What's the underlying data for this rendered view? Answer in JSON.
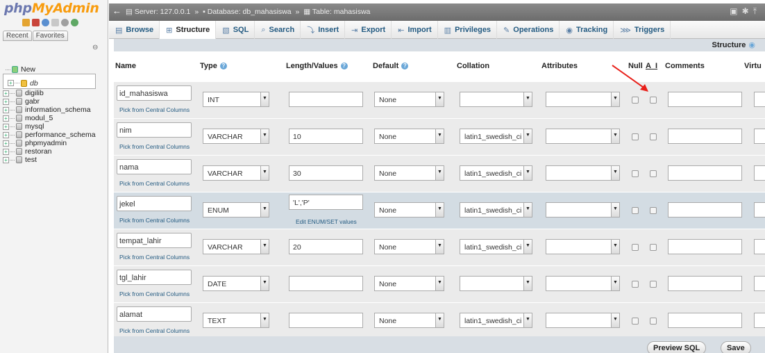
{
  "brand": {
    "part1": "php",
    "part2": "MyAdmin"
  },
  "nav": {
    "recent_tab": "Recent",
    "favorites_tab": "Favorites",
    "databases": [
      {
        "label": "New"
      },
      {
        "label": "db"
      },
      {
        "label": "digilib"
      },
      {
        "label": "gabr"
      },
      {
        "label": "information_schema"
      },
      {
        "label": "modul_5"
      },
      {
        "label": "mysql"
      },
      {
        "label": "performance_schema"
      },
      {
        "label": "phpmyadmin"
      },
      {
        "label": "restoran"
      },
      {
        "label": "test"
      }
    ]
  },
  "breadcrumb": {
    "server": "Server: 127.0.0.1",
    "database": "Database: db_mahasiswa",
    "table": "Table: mahasiswa",
    "separator": "»"
  },
  "tabs": [
    {
      "label": "Browse",
      "icon": "browse-icon"
    },
    {
      "label": "Structure",
      "icon": "structure-icon",
      "active": true
    },
    {
      "label": "SQL",
      "icon": "sql-icon"
    },
    {
      "label": "Search",
      "icon": "search-icon"
    },
    {
      "label": "Insert",
      "icon": "insert-icon"
    },
    {
      "label": "Export",
      "icon": "export-icon"
    },
    {
      "label": "Import",
      "icon": "import-icon"
    },
    {
      "label": "Privileges",
      "icon": "privileges-icon"
    },
    {
      "label": "Operations",
      "icon": "operations-icon"
    },
    {
      "label": "Tracking",
      "icon": "tracking-icon"
    },
    {
      "label": "Triggers",
      "icon": "triggers-icon"
    }
  ],
  "substrip": {
    "structure_link": "Structure"
  },
  "columns": {
    "name": "Name",
    "type": "Type",
    "length": "Length/Values",
    "default": "Default",
    "collation": "Collation",
    "attributes": "Attributes",
    "null": "Null",
    "ai": "A_I",
    "comments": "Comments",
    "virtual": "Virtu"
  },
  "pick_label": "Pick from Central Columns",
  "edit_enum_label": "Edit ENUM/SET values",
  "fields": [
    {
      "name": "id_mahasiswa",
      "type": "INT",
      "length": "",
      "default": "None",
      "collation": ""
    },
    {
      "name": "nim",
      "type": "VARCHAR",
      "length": "10",
      "default": "None",
      "collation": "latin1_swedish_ci"
    },
    {
      "name": "nama",
      "type": "VARCHAR",
      "length": "30",
      "default": "None",
      "collation": "latin1_swedish_ci"
    },
    {
      "name": "jekel",
      "type": "ENUM",
      "length": "'L','P'",
      "default": "None",
      "collation": "latin1_swedish_ci"
    },
    {
      "name": "tempat_lahir",
      "type": "VARCHAR",
      "length": "20",
      "default": "None",
      "collation": "latin1_swedish_ci"
    },
    {
      "name": "tgl_lahir",
      "type": "DATE",
      "length": "",
      "default": "None",
      "collation": ""
    },
    {
      "name": "alamat",
      "type": "TEXT",
      "length": "",
      "default": "None",
      "collation": "latin1_swedish_ci"
    }
  ],
  "buttons": {
    "preview_sql": "Preview SQL",
    "save": "Save"
  },
  "colors": {
    "link": "#235a81",
    "arrow": "#e8201a",
    "header_bar": "#7a7a7a",
    "row_bg": "#ebebeb",
    "row_highlight": "#d3dce3"
  }
}
